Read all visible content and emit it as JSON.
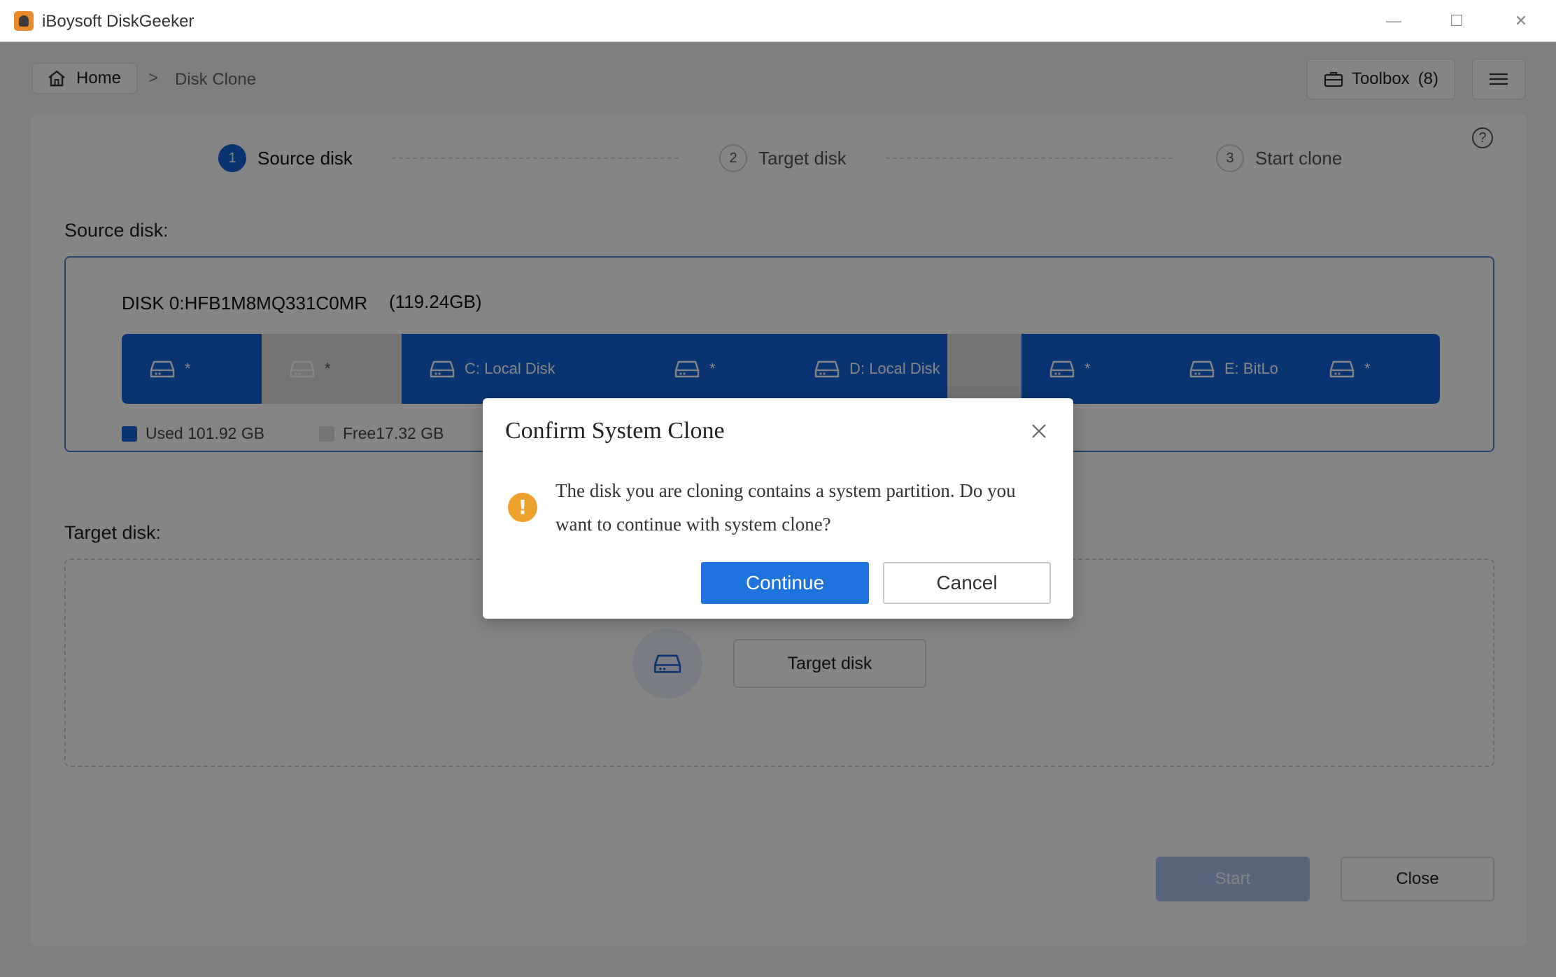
{
  "window": {
    "title": "iBoysoft DiskGeeker",
    "minimize_glyph": "—",
    "maximize_glyph": "☐",
    "close_glyph": "✕"
  },
  "breadcrumb": {
    "home_label": "Home",
    "separator": ">",
    "current": "Disk Clone"
  },
  "toolbar": {
    "toolbox_label": "Toolbox",
    "toolbox_count": "(8)"
  },
  "help_glyph": "?",
  "steps": [
    {
      "number": "1",
      "label": "Source disk",
      "active": true
    },
    {
      "number": "2",
      "label": "Target disk",
      "active": false
    },
    {
      "number": "3",
      "label": "Start clone",
      "active": false
    }
  ],
  "source": {
    "section_label": "Source disk:",
    "disk_name": "DISK 0:HFB1M8MQ331C0MR",
    "disk_size": "(119.24GB)",
    "partitions": [
      {
        "label": "*",
        "type": "used"
      },
      {
        "label": "*",
        "type": "free"
      },
      {
        "label": "C: Local Disk",
        "type": "used"
      },
      {
        "label": "*",
        "type": "used"
      },
      {
        "label": "D: Local Disk",
        "type": "used"
      },
      {
        "label": "",
        "type": "free"
      },
      {
        "label": "*",
        "type": "used"
      },
      {
        "label": "E: BitLo",
        "type": "used"
      },
      {
        "label": "*",
        "type": "used"
      }
    ],
    "legend": {
      "used_label": "Used 101.92 GB",
      "free_label": "Free17.32 GB"
    }
  },
  "target": {
    "section_label": "Target disk:",
    "button_label": "Target disk"
  },
  "actions": {
    "start_label": "Start",
    "close_label": "Close"
  },
  "dialog": {
    "title": "Confirm System Clone",
    "warning_glyph": "!",
    "message": "The disk you are cloning contains a system partition. Do you want to continue with system clone?",
    "continue_label": "Continue",
    "cancel_label": "Cancel"
  },
  "colors": {
    "accent": "#1565d8",
    "used_partition": "#1565d8",
    "free_partition": "#dcdcdc",
    "warning": "#efa12d",
    "continue_button": "#1e73dc"
  }
}
